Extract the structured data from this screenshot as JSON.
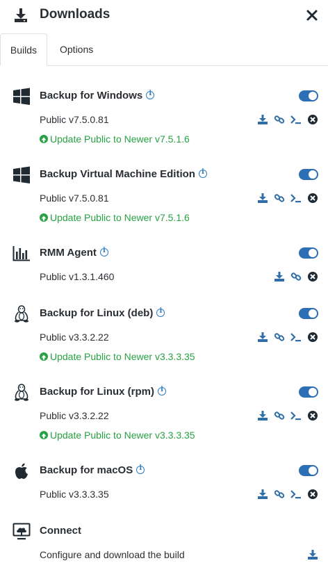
{
  "header": {
    "title": "Downloads"
  },
  "tabs": [
    {
      "label": "Builds"
    },
    {
      "label": "Options"
    }
  ],
  "builds": [
    {
      "name": "Backup for Windows",
      "version": "Public v7.5.0.81",
      "update": "Update Public to Newer v7.5.1.6",
      "toggle_on": true,
      "os_icon": "windows-icon"
    },
    {
      "name": "Backup Virtual Machine Edition",
      "version": "Public v7.5.0.81",
      "update": "Update Public to Newer v7.5.1.6",
      "toggle_on": true,
      "os_icon": "windows-icon"
    },
    {
      "name": "RMM Agent",
      "version": "Public v1.3.1.460",
      "toggle_on": true,
      "os_icon": "bar-chart-icon"
    },
    {
      "name": "Backup for Linux (deb)",
      "version": "Public v3.3.2.22",
      "update": "Update Public to Newer v3.3.3.35",
      "toggle_on": true,
      "os_icon": "linux-tux-icon"
    },
    {
      "name": "Backup for Linux (rpm)",
      "version": "Public v3.3.2.22",
      "update": "Update Public to Newer v3.3.3.35",
      "toggle_on": true,
      "os_icon": "linux-tux-icon"
    },
    {
      "name": "Backup for macOS",
      "version": "Public v3.3.3.35",
      "toggle_on": true,
      "os_icon": "apple-icon"
    }
  ],
  "connect": {
    "name": "Connect",
    "text": "Configure and download the build",
    "os_icon": "monitor-cloud-icon"
  },
  "colors": {
    "accent": "#2c6fb4",
    "update_green": "#27a243",
    "icon_blue": "#2f6ea8"
  }
}
